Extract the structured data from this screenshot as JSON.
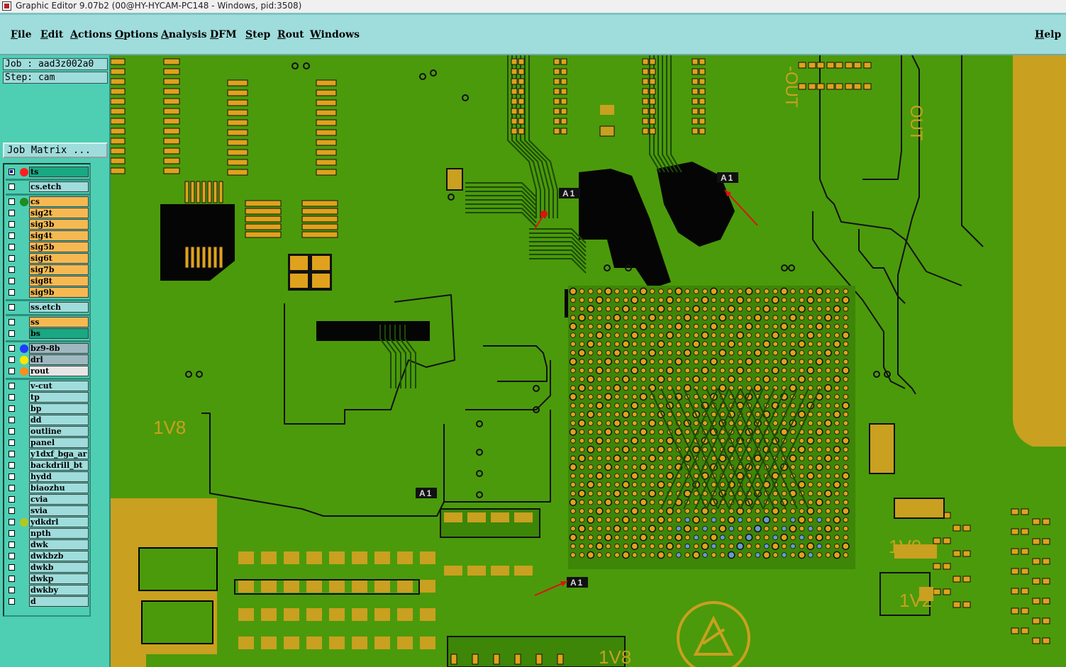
{
  "window": {
    "title": "Graphic Editor 9.07b2 (00@HY-HYCAM-PC148 - Windows, pid:3508)"
  },
  "menubar": {
    "items": [
      "File",
      "Edit",
      "Actions",
      "Options",
      "Analysis",
      "DFM",
      "Step",
      "Rout",
      "Windows"
    ],
    "help": "Help"
  },
  "job": {
    "job_line": "Job : aad3z002a0",
    "step_line": "Step: cam",
    "matrix_button": "Job Matrix ..."
  },
  "layers": [
    {
      "name": "ts",
      "bg": "#1aa882",
      "dot": "#ff1e1e",
      "checked": true,
      "group": 0
    },
    {
      "name": "cs.etch",
      "bg": "#9fdcdc",
      "dot": null,
      "checked": false,
      "group": 1
    },
    {
      "name": "cs",
      "bg": "#f6b952",
      "dot": "#1e8c1e",
      "checked": false,
      "group": 2
    },
    {
      "name": "sig2t",
      "bg": "#f6b952",
      "dot": null,
      "checked": false,
      "group": 2
    },
    {
      "name": "sig3b",
      "bg": "#f6b952",
      "dot": null,
      "checked": false,
      "group": 2
    },
    {
      "name": "sig4t",
      "bg": "#f6b952",
      "dot": null,
      "checked": false,
      "group": 2
    },
    {
      "name": "sig5b",
      "bg": "#f6b952",
      "dot": null,
      "checked": false,
      "group": 2
    },
    {
      "name": "sig6t",
      "bg": "#f6b952",
      "dot": null,
      "checked": false,
      "group": 2
    },
    {
      "name": "sig7b",
      "bg": "#f6b952",
      "dot": null,
      "checked": false,
      "group": 2
    },
    {
      "name": "sig8t",
      "bg": "#f6b952",
      "dot": null,
      "checked": false,
      "group": 2
    },
    {
      "name": "sig9b",
      "bg": "#f6b952",
      "dot": null,
      "checked": false,
      "group": 2
    },
    {
      "name": "ss.etch",
      "bg": "#9fdcdc",
      "dot": null,
      "checked": false,
      "group": 3
    },
    {
      "name": "ss",
      "bg": "#f6b952",
      "dot": null,
      "checked": false,
      "group": 4
    },
    {
      "name": "bs",
      "bg": "#1aa882",
      "dot": null,
      "checked": false,
      "group": 4
    },
    {
      "name": "bz9-8b",
      "bg": "#9fb8c0",
      "dot": "#1e3cff",
      "checked": false,
      "group": 5
    },
    {
      "name": "drl",
      "bg": "#9fb8c0",
      "dot": "#ffe600",
      "checked": false,
      "group": 5
    },
    {
      "name": "rout",
      "bg": "#e6e6e6",
      "dot": "#ff8c1e",
      "checked": false,
      "group": 5
    },
    {
      "name": "v-cut",
      "bg": "#9fdcdc",
      "dot": null,
      "checked": false,
      "group": 6
    },
    {
      "name": "tp",
      "bg": "#9fdcdc",
      "dot": null,
      "checked": false,
      "group": 6
    },
    {
      "name": "bp",
      "bg": "#9fdcdc",
      "dot": null,
      "checked": false,
      "group": 6
    },
    {
      "name": "dd",
      "bg": "#9fdcdc",
      "dot": null,
      "checked": false,
      "group": 6
    },
    {
      "name": "outline",
      "bg": "#9fdcdc",
      "dot": null,
      "checked": false,
      "group": 6
    },
    {
      "name": "panel",
      "bg": "#9fdcdc",
      "dot": null,
      "checked": false,
      "group": 6
    },
    {
      "name": "y1dxf_bga_ar",
      "bg": "#9fdcdc",
      "dot": null,
      "checked": false,
      "group": 6
    },
    {
      "name": "backdrill_bt",
      "bg": "#9fdcdc",
      "dot": null,
      "checked": false,
      "group": 6
    },
    {
      "name": "hydd",
      "bg": "#9fdcdc",
      "dot": null,
      "checked": false,
      "group": 6
    },
    {
      "name": "biaozhu",
      "bg": "#9fdcdc",
      "dot": null,
      "checked": false,
      "group": 6
    },
    {
      "name": "cvia",
      "bg": "#9fdcdc",
      "dot": null,
      "checked": false,
      "group": 6
    },
    {
      "name": "svia",
      "bg": "#9fdcdc",
      "dot": null,
      "checked": false,
      "group": 6
    },
    {
      "name": "ydkdrl",
      "bg": "#9fdcdc",
      "dot": "#b4c81e",
      "checked": false,
      "group": 6
    },
    {
      "name": "npth",
      "bg": "#9fdcdc",
      "dot": null,
      "checked": false,
      "group": 6
    },
    {
      "name": "dwk",
      "bg": "#9fdcdc",
      "dot": null,
      "checked": false,
      "group": 6
    },
    {
      "name": "dwkbzb",
      "bg": "#9fdcdc",
      "dot": null,
      "checked": false,
      "group": 6
    },
    {
      "name": "dwkb",
      "bg": "#9fdcdc",
      "dot": null,
      "checked": false,
      "group": 6
    },
    {
      "name": "dwkp",
      "bg": "#9fdcdc",
      "dot": null,
      "checked": false,
      "group": 6
    },
    {
      "name": "dwkby",
      "bg": "#9fdcdc",
      "dot": null,
      "checked": false,
      "group": 6
    },
    {
      "name": "d",
      "bg": "#9fdcdc",
      "dot": null,
      "checked": false,
      "group": 6
    }
  ],
  "board": {
    "colors": {
      "board": "#4b9a0b",
      "copper": "#c9a020",
      "pad": "#e0a21c",
      "void": "#050505",
      "trace": "#1c4a06",
      "arrow": "#e01010",
      "blue_pad": "#6a9ad0"
    },
    "labels": {
      "a1": "A1",
      "v1v8": "1V8",
      "v1v0": "1V0",
      "v1v2": "1V2",
      "out": "OUT",
      "out2": "-OUT"
    }
  }
}
